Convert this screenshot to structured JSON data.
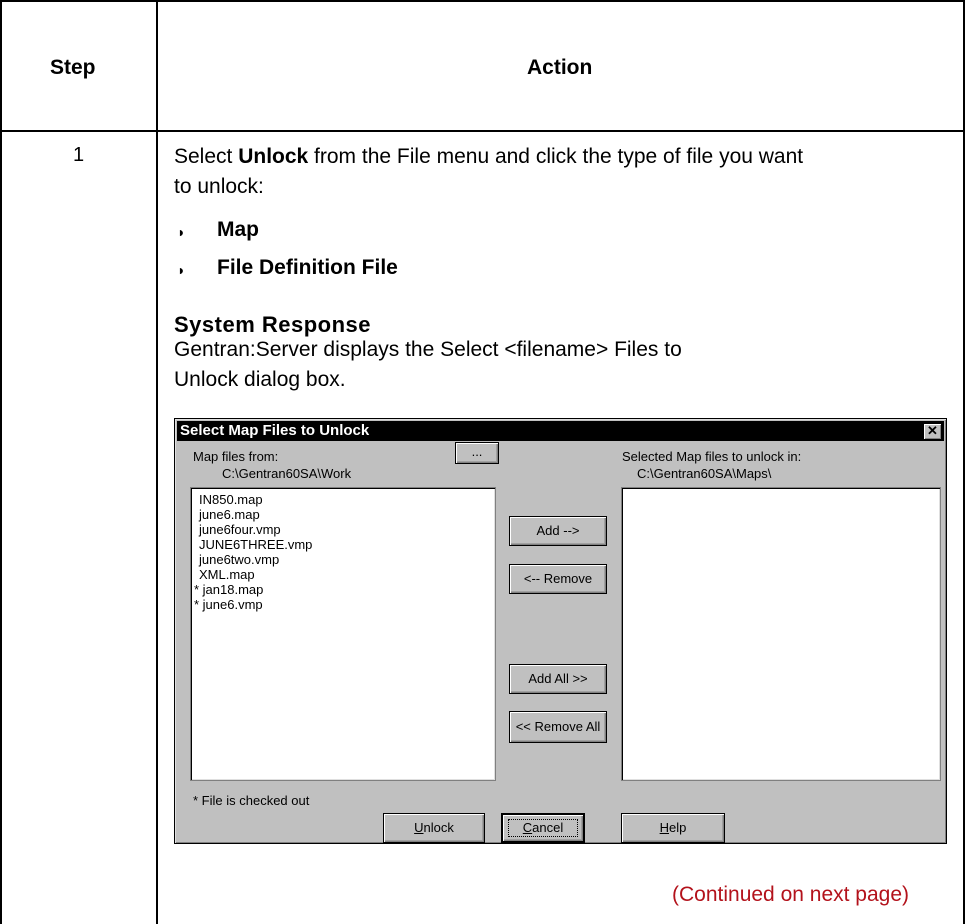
{
  "table": {
    "headers": {
      "step": "Step",
      "action": "Action"
    },
    "row": {
      "step": "1",
      "instruction_pre": "Select ",
      "instruction_bold": "Unlock",
      "instruction_post": " from the File menu and click the type of file you want",
      "instruction_line2": "to unlock:",
      "bullets": [
        "Map",
        "File Definition File"
      ],
      "bullet_glyph": "◗",
      "system_response_heading": "System Response",
      "system_response_line1": "Gentran:Server displays the Select <filename> Files to",
      "system_response_line2": "Unlock dialog box.",
      "continued": "(Continued on next page)"
    }
  },
  "dialog": {
    "title": "Select Map Files to Unlock",
    "close_icon": "close-x-icon",
    "left": {
      "label": "Map files from:",
      "path": "C:\\Gentran60SA\\Work",
      "browse_label": "...",
      "files": [
        "IN850.map",
        "june6.map",
        "june6four.vmp",
        "JUNE6THREE.vmp",
        "june6two.vmp",
        "XML.map",
        "* jan18.map",
        "* june6.vmp"
      ]
    },
    "right": {
      "label": "Selected Map files to unlock in:",
      "path": "C:\\Gentran60SA\\Maps\\"
    },
    "buttons": {
      "add": "Add -->",
      "remove": "<-- Remove",
      "add_all": "Add All  >>",
      "remove_all": "<< Remove All",
      "unlock_u": "U",
      "unlock_rest": "nlock",
      "cancel_u": "C",
      "cancel_rest": "ancel",
      "help_u": "H",
      "help_rest": "elp"
    },
    "footnote": "* File is checked out"
  },
  "colors": {
    "continued": "#b3121b",
    "dialog_bg": "#c0c0c0",
    "titlebar": "#000000"
  }
}
